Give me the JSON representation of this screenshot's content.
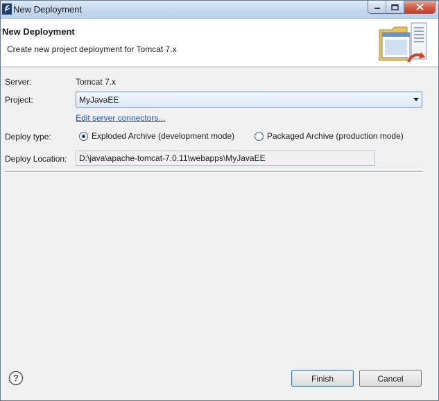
{
  "window": {
    "title": "New Deployment",
    "controls": [
      "minimize",
      "maximize",
      "close"
    ]
  },
  "banner": {
    "title": "New Deployment",
    "description": "Create new project deployment for Tomcat  7.x"
  },
  "form": {
    "server_label": "Server:",
    "server_value": "Tomcat  7.x",
    "project_label": "Project:",
    "project_value": "MyJavaEE",
    "edit_link": "Edit server connectors...",
    "deploy_type_label": "Deploy type:",
    "deploy_type_options": [
      {
        "label": "Exploded Archive (development mode)",
        "selected": true
      },
      {
        "label": "Packaged Archive (production mode)",
        "selected": false
      }
    ],
    "deploy_location_label": "Deploy Location:",
    "deploy_location_value": "D:\\java\\apache-tomcat-7.0.11\\webapps\\MyJavaEE"
  },
  "footer": {
    "finish_label": "Finish",
    "cancel_label": "Cancel"
  },
  "icons": {
    "app": "myeclipse-icon",
    "banner": "deploy-server-icon",
    "help": "help-icon"
  },
  "colors": {
    "titlebar": "#c4d7ee",
    "link": "#1a56b6",
    "close": "#c0412a"
  }
}
